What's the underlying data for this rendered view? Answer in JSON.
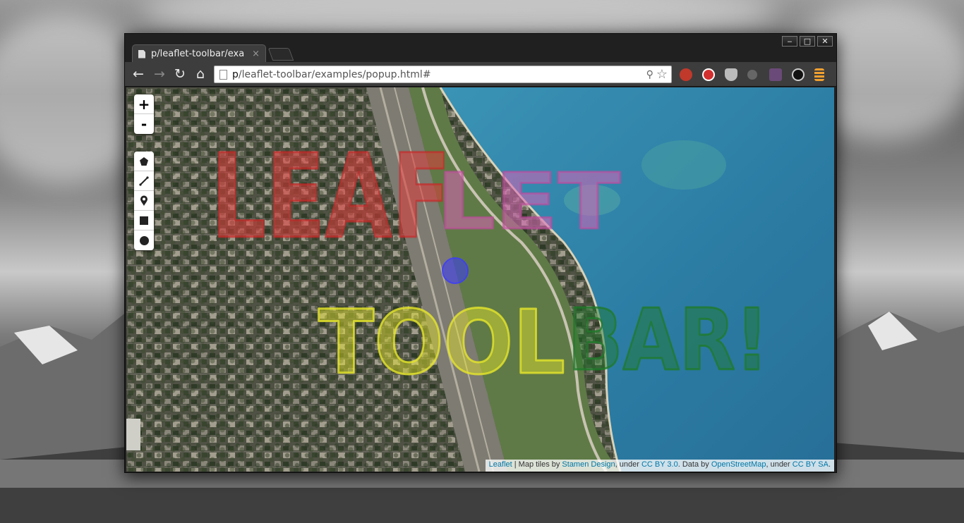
{
  "browser": {
    "tab_title": "p/leaflet-toolbar/exa",
    "tab_close": "×",
    "url_main": "p",
    "url_rest": "/leaflet-toolbar/examples/popup.html#",
    "window_controls": {
      "minimize": "‒",
      "maximize": "□",
      "close": "✕"
    },
    "nav": {
      "back": "←",
      "forward": "→",
      "reload": "↻",
      "home": "⌂"
    }
  },
  "map": {
    "zoom_in": "+",
    "zoom_out": "-",
    "draw_tools": [
      "polygon-icon",
      "polyline-icon",
      "marker-icon",
      "rectangle-icon",
      "circle-icon"
    ],
    "overlay_words": {
      "leaflet_red": "LEAF",
      "leaflet_pink": "LET",
      "toolbar_yellow": "TOOL",
      "toolbar_green": "BAR!"
    },
    "colors": {
      "red": "#e03a3a",
      "pink": "#d865b6",
      "yellow": "#e6e62a",
      "green": "#1f7a2a",
      "blue": "#3b3bff",
      "water": "#2d7fa6"
    }
  },
  "attribution": {
    "leaflet": "Leaflet",
    "sep1": " | Map tiles by ",
    "stamen": "Stamen Design",
    "sep2": ", under ",
    "cc_by": "CC BY 3.0",
    "sep3": ". Data by ",
    "osm": "OpenStreetMap",
    "sep4": ", under ",
    "cc_by_sa": "CC BY SA",
    "end": "."
  }
}
